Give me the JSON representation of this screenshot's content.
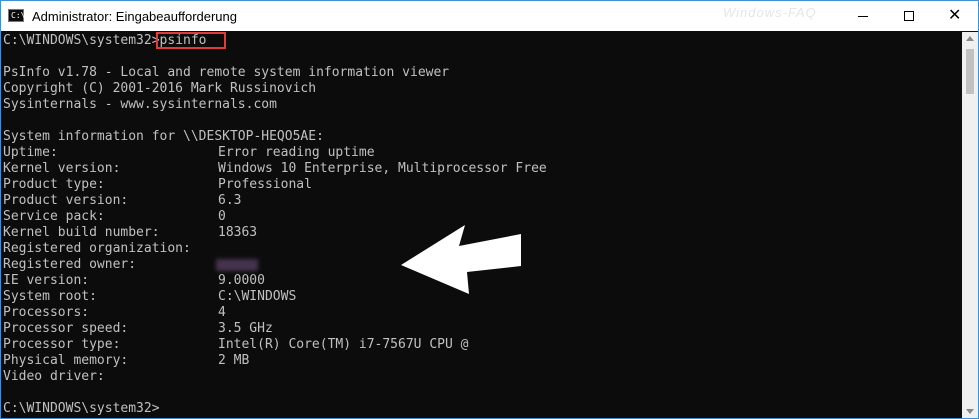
{
  "window": {
    "title": "Administrator: Eingabeaufforderung",
    "watermark": "Windows-FAQ",
    "icon": "cmd-icon"
  },
  "titlebar_buttons": {
    "minimize": "minimize-icon",
    "maximize": "maximize-icon",
    "close": "close-icon"
  },
  "console": {
    "prompt1": "C:\\WINDOWS\\system32>",
    "command": "psinfo",
    "header": [
      "PsInfo v1.78 - Local and remote system information viewer",
      "Copyright (C) 2001-2016 Mark Russinovich",
      "Sysinternals - www.sysinternals.com"
    ],
    "system_info_line": "System information for \\\\DESKTOP-HEQO5AE:",
    "rows": [
      {
        "label": "Uptime:",
        "value": "Error reading uptime"
      },
      {
        "label": "Kernel version:",
        "value": "Windows 10 Enterprise, Multiprocessor Free"
      },
      {
        "label": "Product type:",
        "value": "Professional"
      },
      {
        "label": "Product version:",
        "value": "6.3"
      },
      {
        "label": "Service pack:",
        "value": "0"
      },
      {
        "label": "Kernel build number:",
        "value": "18363"
      },
      {
        "label": "Registered organization:",
        "value": ""
      },
      {
        "label": "Registered owner:",
        "value": ""
      },
      {
        "label": "IE version:",
        "value": "9.0000"
      },
      {
        "label": "System root:",
        "value": "C:\\WINDOWS"
      },
      {
        "label": "Processors:",
        "value": "4"
      },
      {
        "label": "Processor speed:",
        "value": "3.5 GHz"
      },
      {
        "label": "Processor type:",
        "value": "Intel(R) Core(TM) i7-7567U CPU @"
      },
      {
        "label": "Physical memory:",
        "value": "2 MB"
      },
      {
        "label": "Video driver:",
        "value": ""
      }
    ],
    "prompt2": "C:\\WINDOWS\\system32>"
  },
  "colors": {
    "console_bg": "#0c0c0c",
    "console_text": "#c0c0c0",
    "highlight_box": "#e03a3a",
    "annotation_arrow": "#ffffff"
  }
}
